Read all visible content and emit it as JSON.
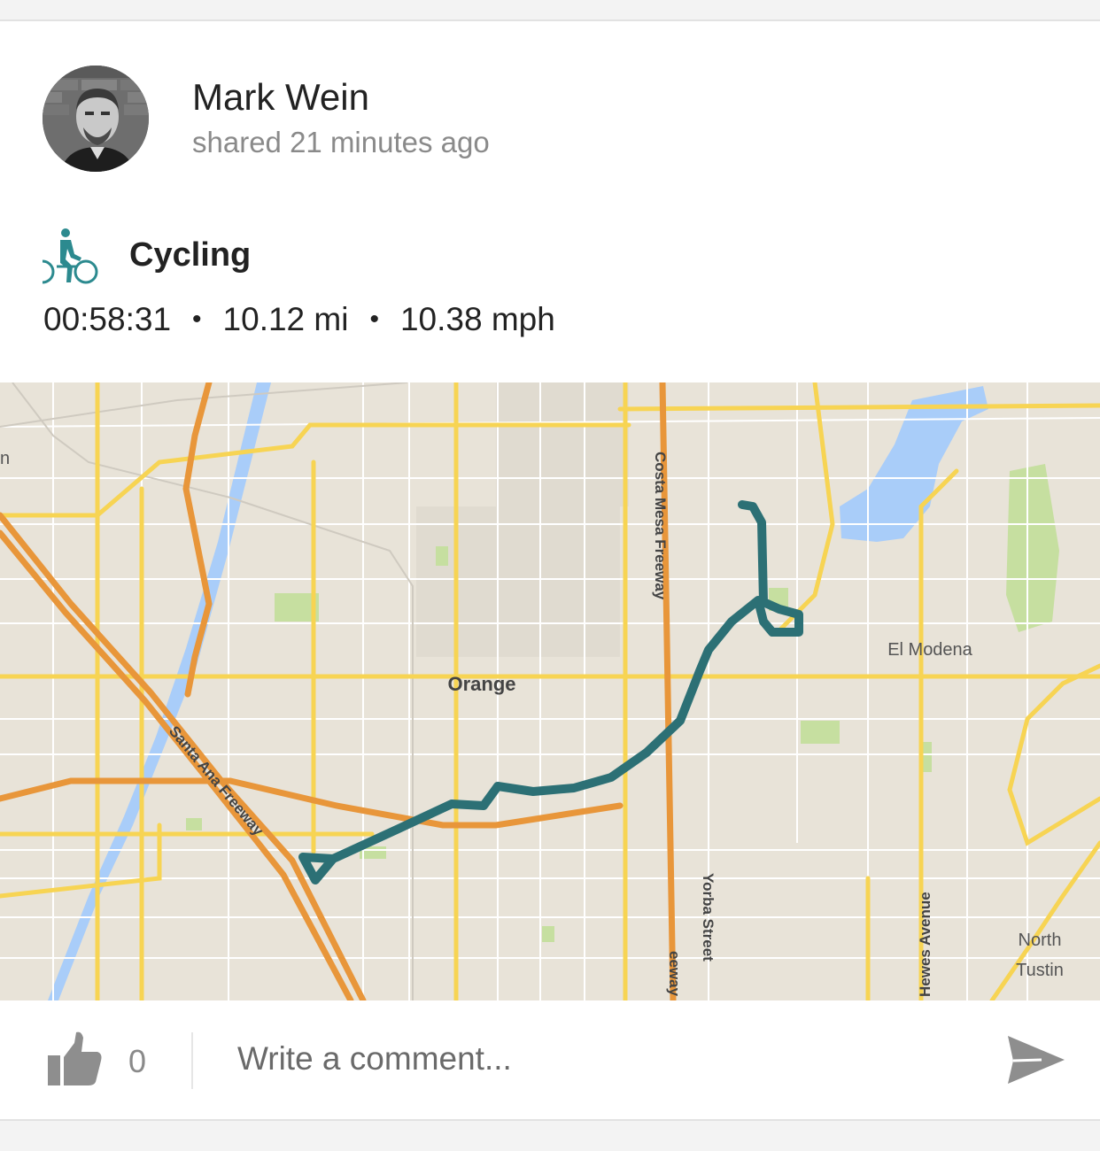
{
  "post": {
    "author": "Mark Wein",
    "shared_time": "shared 21 minutes ago"
  },
  "activity": {
    "icon": "cycling-icon",
    "type": "Cycling",
    "duration": "00:58:31",
    "distance": "10.12 mi",
    "speed": "10.38 mph",
    "separator": "•"
  },
  "map": {
    "labels": {
      "city_orange": "Orange",
      "el_modena": "El Modena",
      "north": "North",
      "tustin": "Tustin",
      "costa_mesa_fwy": "Costa Mesa Freeway",
      "costa_mesa_fwy_partial": "eeway",
      "santa_ana_fwy": "Santa Ana Freeway",
      "yorba_street": "Yorba Street",
      "hewes_avenue": "Hewes Avenue",
      "edge_letter": "n"
    },
    "colors": {
      "land": "#e8e3d8",
      "street": "#ffffff",
      "arterial": "#f7d453",
      "freeway": "#f0a040",
      "water": "#a9cdf9",
      "park": "#c6dfa0",
      "route": "#2c7075"
    }
  },
  "footer": {
    "like_icon": "thumbs-up-icon",
    "like_count": "0",
    "comment_placeholder": "Write a comment...",
    "send_icon": "send-icon"
  }
}
